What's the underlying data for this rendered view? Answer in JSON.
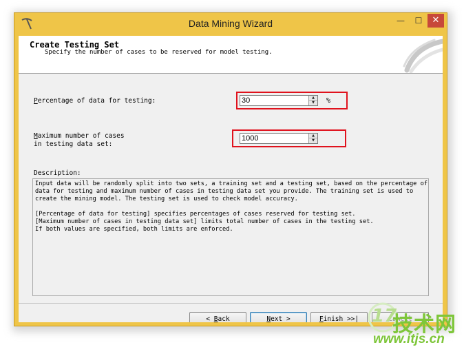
{
  "window": {
    "title": "Data Mining Wizard",
    "min_glyph": "—",
    "max_glyph": "☐",
    "close_glyph": "✕",
    "app_icon": "pickaxe-icon"
  },
  "header": {
    "title": "Create Testing Set",
    "subtitle": "Specify the number of cases to be reserved for model testing."
  },
  "percentage": {
    "label_mnemonic": "P",
    "label_rest": "ercentage of data for testing:",
    "value": "30",
    "unit": "%"
  },
  "max_cases": {
    "label_mnemonic": "M",
    "label_rest_line1": "aximum number of cases",
    "label_line2": "in testing data set:",
    "value": "1000"
  },
  "description": {
    "label": "Description:",
    "lines": [
      "Input data will be randomly split into two sets, a training set and a testing set, based on the percentage of",
      "data for testing and maximum number of cases in testing data set you provide. The training set is used to",
      "create the mining model. The testing set is used to check model accuracy.",
      "",
      "[Percentage of data for testing] specifies percentages of cases reserved for testing set.",
      "[Maximum number of cases in testing data set] limits total number of cases in the testing set.",
      "If both values are specified, both limits are enforced."
    ]
  },
  "buttons": {
    "back_prefix": "< ",
    "back_mnemonic": "B",
    "back_rest": "ack",
    "next_mnemonic": "N",
    "next_rest": "ext >",
    "finish_mnemonic": "F",
    "finish_rest": "inish >>|",
    "cancel": "Cancel"
  },
  "watermark": {
    "logo": "17",
    "brand": "技术网",
    "url": "www.itjs.cn"
  },
  "colors": {
    "window_frame": "#efc548",
    "highlight": "#e0121d",
    "close_button": "#c7483a",
    "watermark": "#7ec63a"
  }
}
